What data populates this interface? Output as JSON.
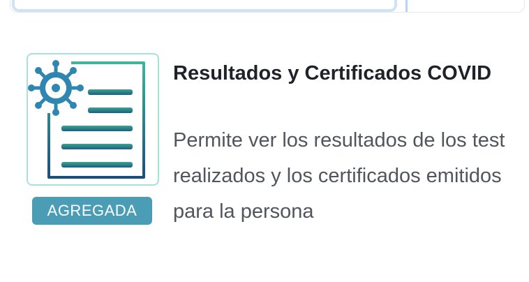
{
  "service": {
    "title": "Resultados y Certificados COVID",
    "description": "Permite ver los resultados de los test realizados y los certificados emitidos para la persona",
    "status_badge": "AGREGADA",
    "icon": "covid-certificate-icon"
  },
  "colors": {
    "badge": "#4a9db5",
    "icon_border": "#a6e3d6",
    "icon_virus": "#2f86b0",
    "icon_lines": "#3a8f8f"
  }
}
